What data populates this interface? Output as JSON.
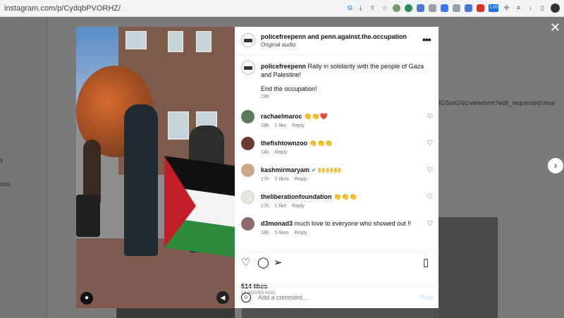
{
  "browser": {
    "url": "instagram.com/p/CydqbPVORHZ/",
    "badge_text": "1.00"
  },
  "background": {
    "right_link_text": "IGSreGNc/viewform?edit_requested=true",
    "left_text_fragment_1": "s",
    "left_text_fragment_2": "ons"
  },
  "post": {
    "header": {
      "accounts": "policefreepenn and penn.against.the.occupation",
      "audio": "Original audio"
    },
    "caption": {
      "username": "policefreepenn",
      "text": "Rally in solidarity with the people of Gaza and Palestine!",
      "text2": "End the occupation!",
      "time": "19h"
    },
    "comments": [
      {
        "username": "rachaelmaroc",
        "text": "👏👏❤️",
        "time": "18h",
        "likes": "1 like",
        "reply": "Reply",
        "avatar_color": "#5b7a5a"
      },
      {
        "username": "thefishtownzoo",
        "text": "👏👏👏",
        "time": "14h",
        "likes": "",
        "reply": "Reply",
        "avatar_color": "#6b3b2e"
      },
      {
        "username": "kashmirmaryam",
        "verified": "✔",
        "text": "🙌🙌🙌",
        "time": "17h",
        "likes": "2 likes",
        "reply": "Reply",
        "avatar_color": "#c9a88a"
      },
      {
        "username": "theliberationfoundation",
        "text": "👏👏👏",
        "time": "17h",
        "likes": "1 like",
        "reply": "Reply",
        "avatar_color": "#e8e8d8"
      },
      {
        "username": "d3monad3",
        "text": "much love to everyone who showed out !!",
        "time": "18h",
        "likes": "5 likes",
        "reply": "Reply",
        "avatar_color": "#8a6a6a"
      }
    ],
    "likes": "514 likes",
    "posted_ago": "19 HOURS AGO",
    "add_comment_placeholder": "Add a comment...",
    "post_label": "Post"
  },
  "icons": {
    "close": "close-icon",
    "next": "chevron-right-icon",
    "more": "more-icon",
    "like": "heart-icon",
    "comment": "comment-icon",
    "share": "share-icon",
    "save": "bookmark-icon",
    "emoji": "emoji-icon"
  }
}
